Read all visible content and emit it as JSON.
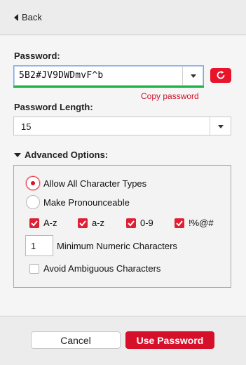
{
  "header": {
    "back_label": "Back"
  },
  "password": {
    "label": "Password:",
    "value": "5B2#JV9DWDmvF^b",
    "copy_label": "Copy password",
    "strength_color": "#1fb445"
  },
  "length": {
    "label": "Password Length:",
    "value": "15"
  },
  "advanced": {
    "label": "Advanced Options:",
    "radio_all": "Allow All Character Types",
    "radio_pronounceable": "Make Pronounceable",
    "checks": [
      {
        "label": "A-z",
        "checked": true
      },
      {
        "label": "a-z",
        "checked": true
      },
      {
        "label": "0-9",
        "checked": true
      },
      {
        "label": "!%@#",
        "checked": true
      }
    ],
    "min_numeric_value": "1",
    "min_numeric_label": "Minimum Numeric Characters",
    "avoid_ambiguous": "Avoid Ambiguous Characters"
  },
  "footer": {
    "cancel_label": "Cancel",
    "use_label": "Use Password"
  },
  "colors": {
    "accent": "#d6102a",
    "strength": "#1fb445"
  },
  "icons": {
    "refresh": "refresh-icon",
    "back": "back-arrow-icon"
  }
}
